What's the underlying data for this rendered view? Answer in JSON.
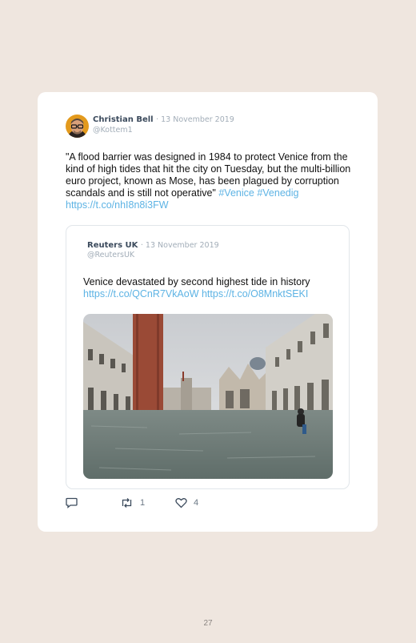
{
  "tweet": {
    "author_name": "Christian Bell",
    "date": "· 13 November 2019",
    "handle": "@Kottem1",
    "text": "\"A flood barrier was designed in 1984 to protect Venice from the kind of high tides that hit the city on Tuesday, but the multi-billion euro project, known as Mose, has been plagued by corruption scandals and is still not operative\"",
    "hashtag_1": "#Venice",
    "hashtag_2": "#Venedig",
    "link": "https://t.co/nhI8n8i3FW"
  },
  "quoted_tweet": {
    "author_name": "Reuters UK",
    "date": "· 13 November 2019",
    "handle": "@ReutersUK",
    "text": "Venice devastated by second highest tide in history",
    "link_1": "https://t.co/QCnR7VkAoW",
    "link_2": "https://t.co/O8MnktSEKI"
  },
  "actions": {
    "reply_icon": "comment-icon",
    "retweet_icon": "retweet-icon",
    "retweet_count": "1",
    "like_icon": "heart-icon",
    "like_count": "4"
  },
  "page_number": "27",
  "colors": {
    "background": "#efe6df",
    "card": "#ffffff",
    "link": "#5db3e4",
    "name": "#3b4a5c",
    "muted": "#a2adb8"
  }
}
